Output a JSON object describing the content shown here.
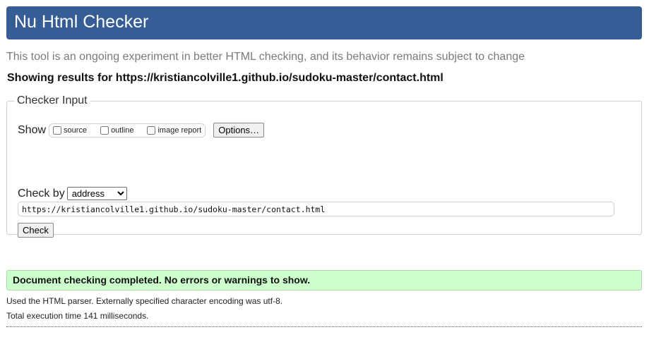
{
  "header": {
    "title": "Nu Html Checker"
  },
  "intro": "This tool is an ongoing experiment in better HTML checking, and its behavior remains subject to change",
  "results_for": "Showing results for https://kristiancolville1.github.io/sudoku-master/contact.html",
  "checker_input": {
    "legend": "Checker Input",
    "show_label": "Show",
    "options": [
      {
        "label": "source",
        "checked": false
      },
      {
        "label": "outline",
        "checked": false
      },
      {
        "label": "image report",
        "checked": false
      }
    ],
    "options_button": "Options…",
    "check_by_label": "Check by",
    "check_by_value": "address",
    "url_value": "https://kristiancolville1.github.io/sudoku-master/contact.html",
    "check_button": "Check"
  },
  "result": {
    "message": "Document checking completed. No errors or warnings to show.",
    "parser_note": "Used the HTML parser. Externally specified character encoding was utf-8.",
    "time_note": "Total execution time 141 milliseconds."
  },
  "colors": {
    "header_bg": "#365d95",
    "success_bg": "#ccffcc",
    "intro_text": "#7a7a7a"
  }
}
